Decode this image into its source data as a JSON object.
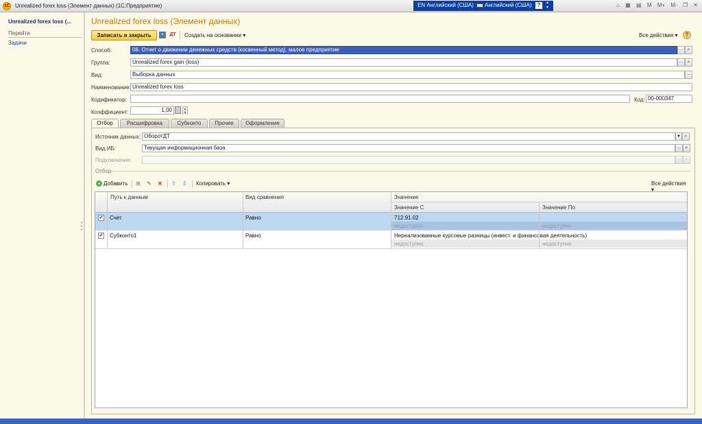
{
  "window": {
    "app_logo": "1C",
    "title": "Unrealized forex loss (Элемент данных)  (1С:Предприятие)",
    "lang_input": "EN Английский (США)",
    "keyboard_layout": "Английский (США)",
    "help_glyph": "?",
    "memory_buttons": [
      "M",
      "M+",
      "M-"
    ]
  },
  "sidebar": {
    "title": "Unrealized forex loss (...",
    "heading": "Перейти",
    "links": [
      "Задачи"
    ]
  },
  "form": {
    "title": "Unrealized forex loss (Элемент данных)",
    "save_close_label": "Записать и закрыть",
    "create_based_label": "Создать на основании ▾",
    "all_actions_label": "Все действия ▾",
    "help_label": "?",
    "fields": {
      "method_label": "Способ:",
      "method_value": "06. Отчет о движении денежных средств (косвенный метод), малое предприятие",
      "group_label": "Группа:",
      "group_value": "Unrealized forex gain (loss)",
      "type_label": "Вид:",
      "type_value": "Выборка данных",
      "name_label": "Наименование:",
      "name_value": "Unrealized forex loss",
      "codifier_label": "Кодификатор:",
      "codifier_value": "",
      "code_label": "Код:",
      "code_value": "00-000347",
      "coef_label": "Коэффициент:",
      "coef_value": "1,00"
    },
    "tabs": [
      "Отбор",
      "Расшифровка",
      "Субконто",
      "Прочее",
      "Оформление"
    ],
    "active_tab": 0
  },
  "filter": {
    "source_label": "Источник данных:",
    "source_value": "ОборотДТ",
    "ib_type_label": "Вид ИБ:",
    "ib_type_value": "Текущая информационная база",
    "connection_label": "Подключение:",
    "connection_value": "",
    "group_title": "Отбор",
    "toolbar": {
      "add_label": "Добавить",
      "copy_label": "Копировать ▾",
      "all_actions_label": "Все действия ▾"
    },
    "grid": {
      "headers": {
        "path": "Путь к данным",
        "comparison": "Вид сравнения",
        "value": "Значение",
        "value_from": "Значение С",
        "value_to": "Значение По"
      },
      "rows": [
        {
          "checked": true,
          "path": "Счет",
          "comparison": "Равно",
          "value": "712.91.02",
          "value_from": "недоступно",
          "value_to": "недоступно",
          "selected": true
        },
        {
          "checked": true,
          "path": "Субконто1",
          "comparison": "Равно",
          "value": "Нереализованные курсовые разницы (инвест. и финансовая деятельность)",
          "value_from": "недоступно",
          "value_to": "недоступно",
          "selected": false
        }
      ]
    }
  },
  "colors": {
    "accent_title": "#c07800",
    "selection": "#3d5fb8",
    "row_selected": "#bcd7f0",
    "primary_button": "#f6c945"
  }
}
